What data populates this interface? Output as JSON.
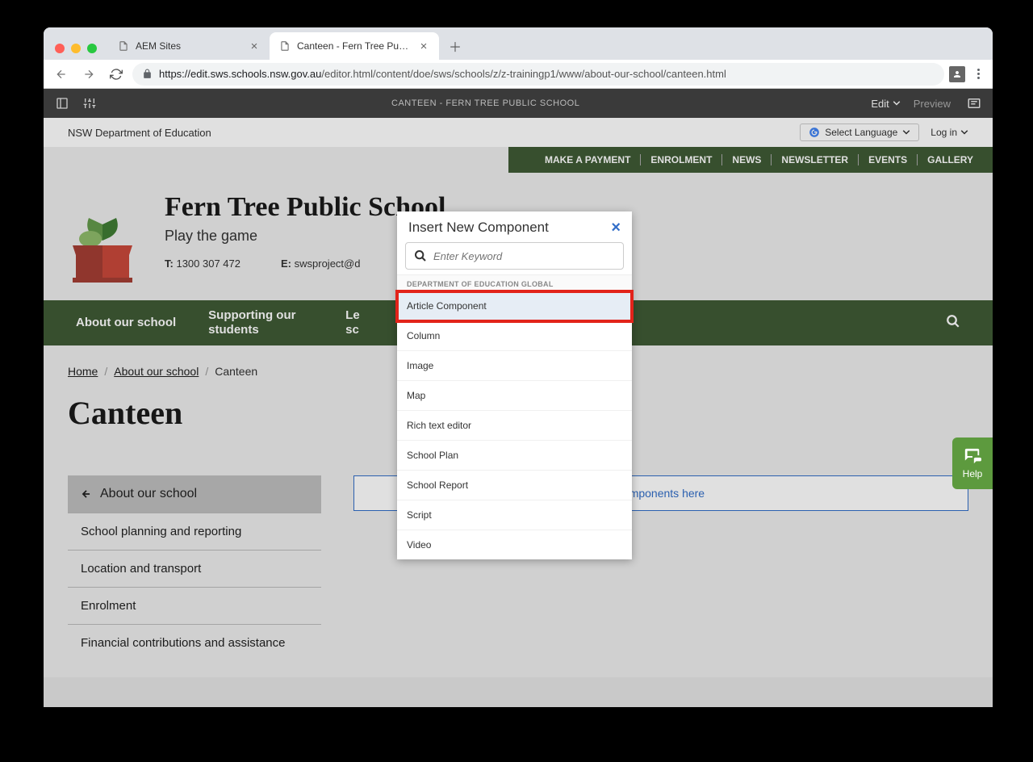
{
  "browser": {
    "tabs": [
      {
        "label": "AEM Sites",
        "active": false
      },
      {
        "label": "Canteen - Fern Tree Public Sch",
        "active": true
      }
    ],
    "url_domain": "https://edit.sws.schools.nsw.gov.au",
    "url_path": "/editor.html/content/doe/sws/schools/z/z-trainingp1/www/about-our-school/canteen.html"
  },
  "aem": {
    "title": "CANTEEN - FERN TREE PUBLIC SCHOOL",
    "edit": "Edit",
    "preview": "Preview"
  },
  "utility": {
    "dept": "NSW Department of Education",
    "lang": "Select Language",
    "login": "Log in"
  },
  "green_nav": [
    "MAKE A PAYMENT",
    "ENROLMENT",
    "NEWS",
    "NEWSLETTER",
    "EVENTS",
    "GALLERY"
  ],
  "school": {
    "name": "Fern Tree Public School",
    "tagline": "Play the game",
    "phone_label": "T:",
    "phone": "1300 307 472",
    "email_label": "E:",
    "email": "swsproject@d"
  },
  "main_nav": [
    "About our school",
    "Supporting our students",
    "Le\nsc"
  ],
  "breadcrumb": {
    "home": "Home",
    "l1": "About our school",
    "current": "Canteen"
  },
  "page_title": "Canteen",
  "sidebar": {
    "active": "About our school",
    "items": [
      "School planning and reporting",
      "Location and transport",
      "Enrolment",
      "Financial contributions and assistance"
    ]
  },
  "dropzone": "components here",
  "help": "Help",
  "modal": {
    "title": "Insert New Component",
    "placeholder": "Enter Keyword",
    "group": "DEPARTMENT OF EDUCATION GLOBAL",
    "options": [
      "Article Component",
      "Column",
      "Image",
      "Map",
      "Rich text editor",
      "School Plan",
      "School Report",
      "Script",
      "Video"
    ],
    "highlighted_index": 0
  }
}
